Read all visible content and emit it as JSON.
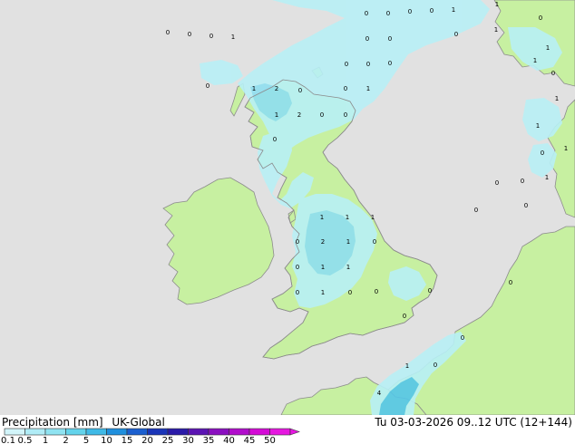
{
  "header": {
    "product": "Precipitation [mm]",
    "model": "UK-Global",
    "valid_time": "Tu 03-03-2026 09..12 UTC (12+144)"
  },
  "legend": {
    "ticks": [
      "0.1",
      "0.5",
      "1",
      "2",
      "5",
      "10",
      "15",
      "20",
      "25",
      "30",
      "35",
      "40",
      "45",
      "50"
    ],
    "colors": [
      "#d2f5fa",
      "#b0ecf6",
      "#8fe3f1",
      "#63d3eb",
      "#3fb9e6",
      "#1f8fdd",
      "#1b5fcf",
      "#1a35b8",
      "#2a1aa8",
      "#5b14b3",
      "#8a0fc0",
      "#b10dcc",
      "#d40ad6",
      "#e617e0"
    ]
  },
  "colors": {
    "sea": "#e1e1e1",
    "land": "#c7f0a1",
    "coast": "#8c8c8c",
    "precip_light": "#b8f0f6",
    "precip_medium": "#8fdff0",
    "precip_heavy": "#55c6e8"
  },
  "map_labels": [
    {
      "id": "fr-nw-1",
      "text": "0"
    },
    {
      "id": "fr-nw-2",
      "text": "0"
    },
    {
      "id": "fr-nw-3",
      "text": "0"
    },
    {
      "id": "fr-nw-4",
      "text": "1"
    },
    {
      "id": "no-1",
      "text": "0"
    },
    {
      "id": "no-2",
      "text": "0"
    },
    {
      "id": "no-3",
      "text": "0"
    },
    {
      "id": "no-4",
      "text": "0"
    },
    {
      "id": "no-5",
      "text": "1"
    },
    {
      "id": "no-6",
      "text": "1"
    },
    {
      "id": "no-7",
      "text": "0"
    },
    {
      "id": "no-8",
      "text": "0"
    },
    {
      "id": "ns-1",
      "text": "0"
    },
    {
      "id": "ns-2",
      "text": "0"
    },
    {
      "id": "ns-3",
      "text": "0"
    },
    {
      "id": "ns-4",
      "text": "0"
    },
    {
      "id": "ns-5",
      "text": "0"
    },
    {
      "id": "sc-1",
      "text": "1"
    },
    {
      "id": "sc-2",
      "text": "2"
    },
    {
      "id": "sc-3",
      "text": "0"
    },
    {
      "id": "sc-4",
      "text": "0"
    },
    {
      "id": "sc-5",
      "text": "1"
    },
    {
      "id": "sc-6",
      "text": "1"
    },
    {
      "id": "sc-7",
      "text": "2"
    },
    {
      "id": "sc-8",
      "text": "0"
    },
    {
      "id": "sc-9",
      "text": "0"
    },
    {
      "id": "sc-10",
      "text": "0"
    },
    {
      "id": "atl-1",
      "text": "0"
    },
    {
      "id": "sw-1",
      "text": "1"
    },
    {
      "id": "sw-2",
      "text": "1"
    },
    {
      "id": "sw-3",
      "text": "0"
    },
    {
      "id": "sw-4",
      "text": "1"
    },
    {
      "id": "sw-5",
      "text": "1"
    },
    {
      "id": "dk-1",
      "text": "1"
    },
    {
      "id": "dk-2",
      "text": "0"
    },
    {
      "id": "dk-3",
      "text": "1"
    },
    {
      "id": "dk-4",
      "text": "0"
    },
    {
      "id": "dk-5",
      "text": "1"
    },
    {
      "id": "nl-1",
      "text": "0"
    },
    {
      "id": "nl-2",
      "text": "0"
    },
    {
      "id": "en-1",
      "text": "1"
    },
    {
      "id": "en-2",
      "text": "1"
    },
    {
      "id": "en-3",
      "text": "1"
    },
    {
      "id": "en-4",
      "text": "0"
    },
    {
      "id": "en-5",
      "text": "2"
    },
    {
      "id": "en-6",
      "text": "1"
    },
    {
      "id": "en-7",
      "text": "0"
    },
    {
      "id": "en-8",
      "text": "0"
    },
    {
      "id": "en-9",
      "text": "1"
    },
    {
      "id": "en-10",
      "text": "1"
    },
    {
      "id": "en-11",
      "text": "0"
    },
    {
      "id": "en-12",
      "text": "1"
    },
    {
      "id": "en-13",
      "text": "0"
    },
    {
      "id": "en-14",
      "text": "0"
    },
    {
      "id": "en-15",
      "text": "0"
    },
    {
      "id": "en-16",
      "text": "0"
    },
    {
      "id": "en-17",
      "text": "0"
    },
    {
      "id": "ch-1",
      "text": "0"
    },
    {
      "id": "ch-2",
      "text": "0"
    },
    {
      "id": "ch-3",
      "text": "0"
    },
    {
      "id": "br-1",
      "text": "1"
    },
    {
      "id": "br-2",
      "text": "4"
    }
  ]
}
